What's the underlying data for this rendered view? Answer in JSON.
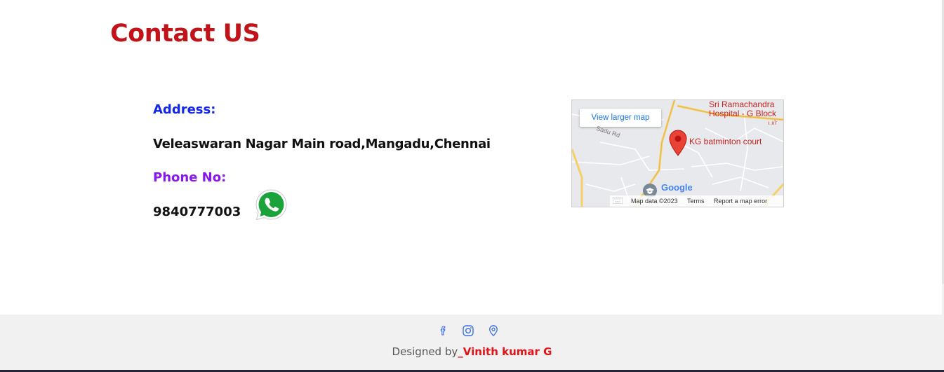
{
  "page": {
    "title": "Contact US"
  },
  "contact": {
    "address_label": "Address:",
    "address_value": "Veleaswaran Nagar Main road,Mangadu,Chennai",
    "phone_label": "Phone No:",
    "phone_value": "9840777003"
  },
  "map": {
    "view_larger_label": "View larger map",
    "road_label": "Sadu Rd",
    "hospital_line1": "Sri Ramachandra",
    "hospital_line2": "Hospital - G Block",
    "hospital_line3": "பர்",
    "place_label": "KG batminton court",
    "logo_text": "Google",
    "map_data": "Map data ©2023",
    "terms": "Terms",
    "report": "Report a map error"
  },
  "footer": {
    "credit_prefix": "Designed by",
    "credit_name": "_Vinith kumar G",
    "icons": [
      "facebook-icon",
      "instagram-icon",
      "location-icon"
    ]
  },
  "colors": {
    "title": "#c0141a",
    "address_label": "#1126e8",
    "phone_label": "#8a16ef",
    "credit_name": "#e31217",
    "footer_bg": "#f1f1f1",
    "icon_blue": "#3d6fe6"
  }
}
